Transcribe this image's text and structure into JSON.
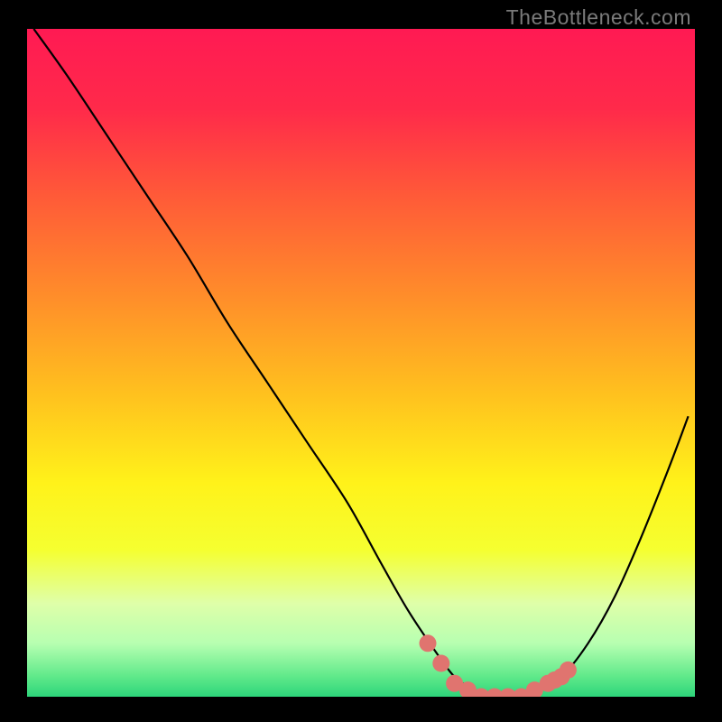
{
  "watermark": "TheBottleneck.com",
  "chart_data": {
    "type": "line",
    "title": "",
    "xlabel": "",
    "ylabel": "",
    "xlim": [
      0,
      100
    ],
    "ylim": [
      0,
      100
    ],
    "grid": false,
    "curve": {
      "name": "bottleneck-curve",
      "x": [
        1,
        6,
        12,
        18,
        24,
        30,
        36,
        42,
        48,
        53,
        57,
        61,
        64,
        67,
        70,
        73,
        76,
        80,
        84,
        88,
        92,
        96,
        99
      ],
      "y": [
        100,
        93,
        84,
        75,
        66,
        56,
        47,
        38,
        29,
        20,
        13,
        7,
        3,
        1,
        0,
        0,
        1,
        3,
        8,
        15,
        24,
        34,
        42
      ]
    },
    "highlight": {
      "name": "optimal-range",
      "color": "#e0746f",
      "points": [
        {
          "x": 60,
          "y": 8
        },
        {
          "x": 62,
          "y": 5
        },
        {
          "x": 64,
          "y": 2
        },
        {
          "x": 66,
          "y": 1
        },
        {
          "x": 68,
          "y": 0
        },
        {
          "x": 70,
          "y": 0
        },
        {
          "x": 72,
          "y": 0
        },
        {
          "x": 74,
          "y": 0
        },
        {
          "x": 76,
          "y": 1
        },
        {
          "x": 78,
          "y": 2
        },
        {
          "x": 79,
          "y": 2.5
        },
        {
          "x": 80,
          "y": 3
        },
        {
          "x": 81,
          "y": 4
        }
      ]
    },
    "background_gradient": {
      "stops": [
        {
          "pos": 0.0,
          "color": "#ff1a53"
        },
        {
          "pos": 0.12,
          "color": "#ff2a4a"
        },
        {
          "pos": 0.25,
          "color": "#ff5a38"
        },
        {
          "pos": 0.4,
          "color": "#ff8d2a"
        },
        {
          "pos": 0.55,
          "color": "#ffc21e"
        },
        {
          "pos": 0.68,
          "color": "#fff21a"
        },
        {
          "pos": 0.78,
          "color": "#f5ff30"
        },
        {
          "pos": 0.86,
          "color": "#dfffa9"
        },
        {
          "pos": 0.92,
          "color": "#b7ffb1"
        },
        {
          "pos": 0.97,
          "color": "#5fe98a"
        },
        {
          "pos": 1.0,
          "color": "#2dd47a"
        }
      ]
    }
  }
}
